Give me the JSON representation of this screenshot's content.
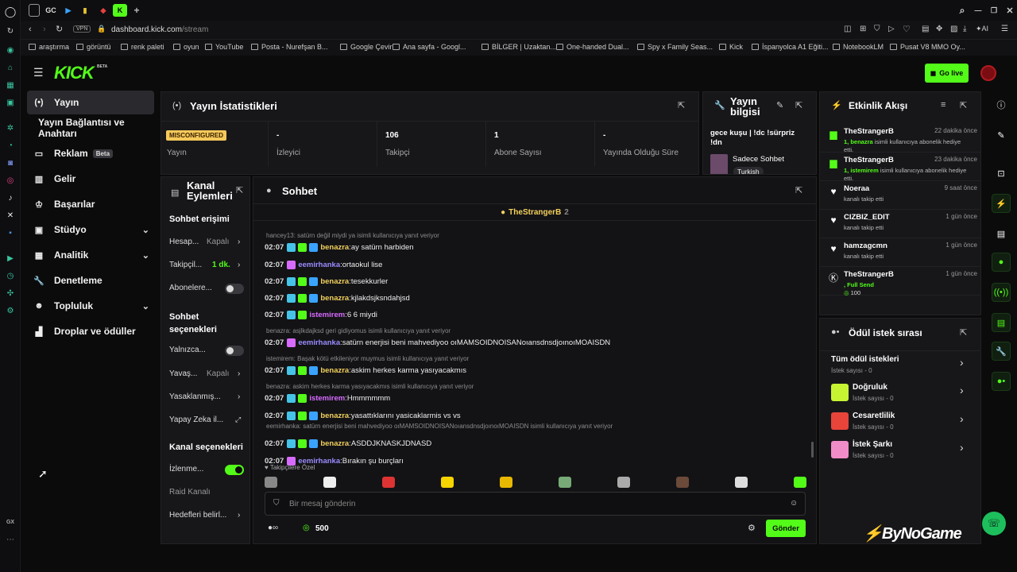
{
  "browser": {
    "url_host": "dashboard.kick.com",
    "url_path": "/stream",
    "vpn_label": "VPN",
    "ai_label": "AI",
    "tab_gc": "GC",
    "tab_k": "K",
    "bookmarks": [
      "araştırma",
      "görüntü",
      "renk paleti",
      "oyun",
      "YouTube",
      "Posta - Nurefşan B...",
      "Google Çeviri",
      "Ana sayfa - Googl...",
      "BİLGER | Uzaktan...",
      "One-handed Dual...",
      "Spy x Family Seas...",
      "Kick",
      "İspanyolca A1 Eğiti...",
      "NotebookLM",
      "Pusat V8 MMO Oy..."
    ],
    "opera_bottom_label": "GX"
  },
  "header": {
    "logo_text": "KICK",
    "logo_beta": "BETA",
    "go_live_label": "Go live",
    "accent": "#53fc18"
  },
  "sidebar": {
    "items": [
      {
        "label": "Yayın"
      },
      {
        "label": "Yayın Bağlantısı ve Anahtarı"
      },
      {
        "label": "Reklam",
        "badge": "Beta"
      },
      {
        "label": "Gelir"
      },
      {
        "label": "Başarılar"
      },
      {
        "label": "Stüdyo"
      },
      {
        "label": "Analitik"
      },
      {
        "label": "Denetleme"
      },
      {
        "label": "Topluluk"
      },
      {
        "label": "Droplar ve ödüller"
      }
    ]
  },
  "stats": {
    "title": "Yayın İstatistikleri",
    "cells": [
      {
        "value": "MISCONFIGURED",
        "label": "Yayın"
      },
      {
        "value": "-",
        "label": "İzleyici"
      },
      {
        "value": "106",
        "label": "Takipçi"
      },
      {
        "value": "1",
        "label": "Abone Sayısı"
      },
      {
        "value": "-",
        "label": "Yayında Olduğu Süre"
      }
    ]
  },
  "stream_info": {
    "title": "Yayın bilgisi",
    "stream_title": "gece kuşu | !dc !sürpriz !dn",
    "category": "Sadece Sohbet",
    "tag": "Turkish"
  },
  "channel_actions": {
    "title": "Kanal Eylemleri",
    "section_chat": "Sohbet erişimi",
    "rows_access": [
      {
        "label": "Hesap...",
        "value": "Kapalı"
      },
      {
        "label": "Takipçil...",
        "value": "1 dk."
      },
      {
        "label": "Abonelere...",
        "value": ""
      }
    ],
    "section_options": "Sohbet seçenekleri",
    "rows_options": [
      {
        "label": "Yalnızca...",
        "value": ""
      },
      {
        "label": "Yavaş...",
        "value": "Kapalı"
      },
      {
        "label": "Yasaklanmış...",
        "value": ""
      },
      {
        "label": "Yapay Zeka il...",
        "value": ""
      }
    ],
    "section_channel": "Kanal seçenekleri",
    "rows_channel": [
      {
        "label": "İzlenme...",
        "value": ""
      },
      {
        "label": "Raid Kanalı",
        "value": ""
      },
      {
        "label": "Hedefleri belirl...",
        "value": ""
      }
    ],
    "toggles": {
      "abonelere": false,
      "yalnizca": false,
      "izlenme": true
    }
  },
  "chat": {
    "title": "Sohbet",
    "pinned_user": "TheStrangerB",
    "pinned_count": "2",
    "lines": [
      {
        "kind": "reply",
        "text": "hancey13: satürn değil miydi ya isimli kullanıcıya yanıt veriyor"
      },
      {
        "kind": "msg",
        "time": "02:07",
        "user": "benazra",
        "color": "#f3d15c",
        "text": "ay satürn harbiden"
      },
      {
        "kind": "msg",
        "time": "02:07",
        "user": "eemirhanka",
        "color": "#9a8cff",
        "text": "ortaokul lise"
      },
      {
        "kind": "msg",
        "time": "02:07",
        "user": "benazra",
        "color": "#f3d15c",
        "text": "tesekkurler"
      },
      {
        "kind": "msg",
        "time": "02:07",
        "user": "benazra",
        "color": "#f3d15c",
        "text": "kjlakdsjksndahjsd"
      },
      {
        "kind": "msg",
        "time": "02:07",
        "user": "istemirem",
        "color": "#d86bff",
        "text": "6 6 miydi"
      },
      {
        "kind": "reply",
        "text": "benazra: asjlkdajksd geri gidiyomus isimli kullanıcıya yanıt veriyor"
      },
      {
        "kind": "msg",
        "time": "02:07",
        "user": "eemirhanka",
        "color": "#9a8cff",
        "text": "satürn enerjisi beni mahvediyoo oıMAMSOIDNOISANoıansdnsdjoınoıMOAISDN"
      },
      {
        "kind": "reply",
        "text": "istemirem: Başak kötü etkileniyor muymus isimli kullanıcıya yanıt veriyor"
      },
      {
        "kind": "msg",
        "time": "02:07",
        "user": "benazra",
        "color": "#f3d15c",
        "text": "askim herkes karma yasıyacakmıs"
      },
      {
        "kind": "reply",
        "text": "benazra: askim herkes karma yasıyacakmıs isimli kullanıcıya yanıt veriyor"
      },
      {
        "kind": "msg",
        "time": "02:07",
        "user": "istemirem",
        "color": "#d86bff",
        "text": "Hmmmmmm"
      },
      {
        "kind": "msg",
        "time": "02:07",
        "user": "benazra",
        "color": "#f3d15c",
        "text": "yasattıklarını yasicaklarmis vs vs"
      },
      {
        "kind": "reply",
        "text": "eemirhanka: satürn enerjisi beni mahvediyoo oıMAMSOIDNOISANoıansdnsdjoınoıMOAISDN isimli kullanıcıya yanıt veriyor"
      },
      {
        "kind": "msg",
        "time": "02:07",
        "user": "benazra",
        "color": "#f3d15c",
        "text": "ASDDJKNASKJDNASD"
      },
      {
        "kind": "msg",
        "time": "02:07",
        "user": "eemirhanka",
        "color": "#9a8cff",
        "text": "Bırakın şu burçları"
      }
    ],
    "emote_label": "Takipçilere Özel",
    "input_placeholder": "Bir mesaj gönderin",
    "points": "500",
    "send_label": "Gönder"
  },
  "activity": {
    "title": "Etkinlik Akışı",
    "events": [
      {
        "name": "TheStrangerB",
        "time": "22 dakika önce",
        "hl": "1, benazra",
        "desc": " isimli kullanıcıya abonelik hediye etti.",
        "icon": "gift-icon"
      },
      {
        "name": "TheStrangerB",
        "time": "23 dakika önce",
        "hl": "1, istemirem",
        "desc": " isimli kullanıcıya abonelik hediye etti.",
        "icon": "gift-icon"
      },
      {
        "name": "Noeraa",
        "time": "9 saat önce",
        "hl": "",
        "desc": "kanalı takip etti",
        "icon": "heart-icon"
      },
      {
        "name": "CIZBIZ_EDIT",
        "time": "1 gün önce",
        "hl": "",
        "desc": "kanalı takip etti",
        "icon": "heart-icon"
      },
      {
        "name": "hamzagcmn",
        "time": "1 gün önce",
        "hl": "",
        "desc": "kanalı takip etti",
        "icon": "heart-icon"
      },
      {
        "name": "TheStrangerB",
        "time": "1 gün önce",
        "hl": ", Full Send",
        "desc": "",
        "extra": "100",
        "icon": "kick-icon"
      }
    ]
  },
  "rewards": {
    "title": "Ödül istek sırası",
    "items": [
      {
        "title": "Tüm ödül istekleri",
        "sub": "İstek sayısı - 0"
      },
      {
        "title": "Doğruluk",
        "sub": "İstek sayısı - 0",
        "color": "#c6f432"
      },
      {
        "title": "Cesaretlilik",
        "sub": "İstek sayısı - 0",
        "color": "#e8443a"
      },
      {
        "title": "İstek Şarkı",
        "sub": "İstek sayısı - 0",
        "color": "#f08cc8"
      }
    ]
  },
  "watermark": "ByNoGame"
}
